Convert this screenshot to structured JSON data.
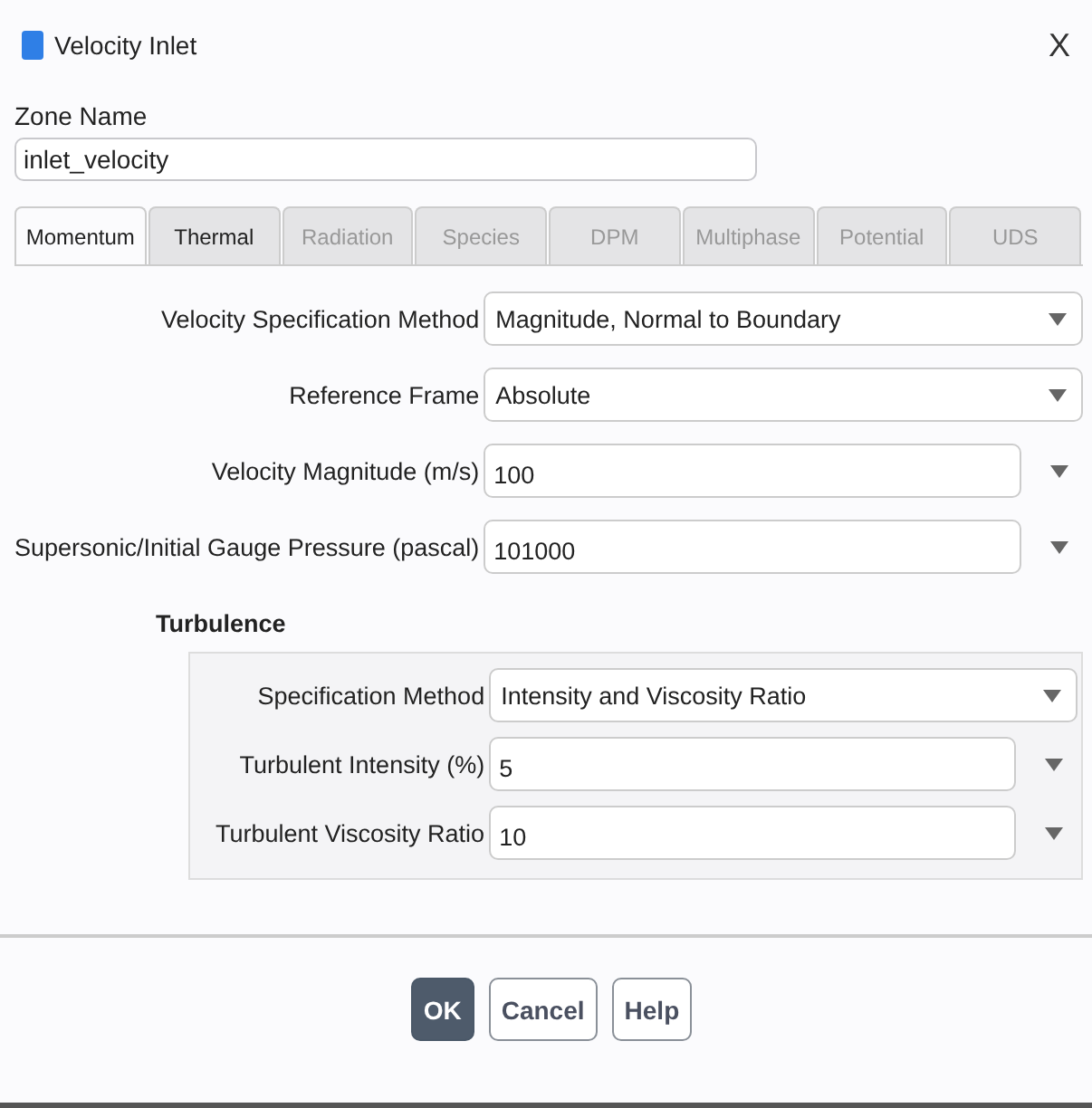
{
  "window": {
    "title": "Velocity Inlet",
    "close": "X"
  },
  "zone_name": {
    "label": "Zone Name",
    "value": "inlet_velocity"
  },
  "tabs": [
    {
      "label": "Momentum",
      "selected": true,
      "disabled": false
    },
    {
      "label": "Thermal",
      "selected": false,
      "disabled": false
    },
    {
      "label": "Radiation",
      "selected": false,
      "disabled": true
    },
    {
      "label": "Species",
      "selected": false,
      "disabled": true
    },
    {
      "label": "DPM",
      "selected": false,
      "disabled": true
    },
    {
      "label": "Multiphase",
      "selected": false,
      "disabled": true
    },
    {
      "label": "Potential",
      "selected": false,
      "disabled": true
    },
    {
      "label": "UDS",
      "selected": false,
      "disabled": true
    }
  ],
  "fields": [
    {
      "kind": "select",
      "label": "Velocity Specification Method",
      "value": "Magnitude, Normal to Boundary"
    },
    {
      "kind": "select",
      "label": "Reference Frame",
      "value": "Absolute"
    },
    {
      "kind": "number",
      "label": "Velocity Magnitude (m/s)",
      "value": "100"
    },
    {
      "kind": "number",
      "label": "Supersonic/Initial Gauge Pressure (pascal)",
      "value": "101000"
    }
  ],
  "turbulence": {
    "title": "Turbulence",
    "fields": [
      {
        "kind": "select",
        "label": "Specification Method",
        "value": "Intensity and Viscosity Ratio"
      },
      {
        "kind": "number",
        "label": "Turbulent Intensity (%)",
        "value": "5"
      },
      {
        "kind": "number",
        "label": "Turbulent Viscosity Ratio",
        "value": "10"
      }
    ]
  },
  "buttons": [
    {
      "label": "OK",
      "primary": true
    },
    {
      "label": "Cancel",
      "primary": false
    },
    {
      "label": "Help",
      "primary": false
    }
  ]
}
